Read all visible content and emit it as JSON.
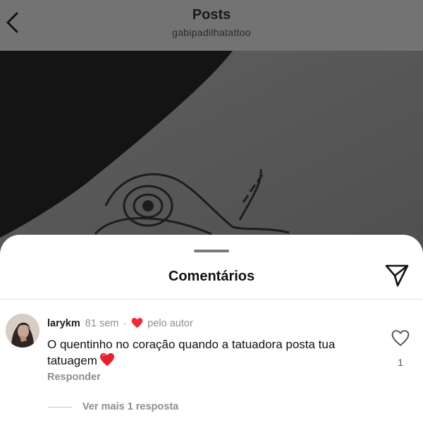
{
  "header": {
    "title": "Posts",
    "username": "gabipadilhatattoo",
    "back_icon": "chevron-left-icon"
  },
  "comments_sheet": {
    "title": "Comentários",
    "share_icon": "paper-plane-icon"
  },
  "comment": {
    "username": "larykm",
    "time": "81 sem",
    "separator": "·",
    "liked_by_author_label": "pelo autor",
    "text": "O quentinho no coração quando a tatuadora posta tua tatuagem",
    "emoji": "red-heart",
    "reply_label": "Responder",
    "like_count": "1",
    "view_replies_label": "Ver mais 1 resposta"
  },
  "colors": {
    "liked_heart": "#ef2b3b",
    "secondary_text": "#8e8e8e",
    "dim_overlay": "#737373"
  }
}
